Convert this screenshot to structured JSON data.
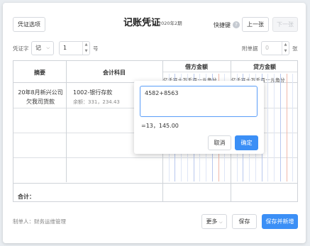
{
  "toolbar": {
    "options_label": "凭证选项",
    "title": "记账凭证",
    "period": "2020年2期",
    "shortcut_label": "快捷键",
    "help_glyph": "?",
    "prev_label": "上一张",
    "next_label": "下一张"
  },
  "meta": {
    "voucher_word_label": "凭证字",
    "voucher_word_value": "记",
    "number_value": "1",
    "number_unit": "号",
    "attachments_label": "附单据",
    "attachments_value": "0",
    "attachments_unit": "张"
  },
  "table": {
    "summary_header": "摘要",
    "account_header": "会计科目",
    "debit_header": "借方金额",
    "credit_header": "贷方金额",
    "digit_units": "亿千百十万千百十元角分",
    "rows": [
      {
        "summary": "20年8月新兴公司欠我司货款",
        "account": "1002-银行存款",
        "balance": "余额：331，234.43"
      }
    ],
    "total_label": "合计："
  },
  "popup": {
    "expression": "4582+8563",
    "result": "=13，145.00",
    "cancel_label": "取消",
    "confirm_label": "确定"
  },
  "footer": {
    "maker": "制单人：财务运维管理",
    "more_label": "更多",
    "save_label": "保存",
    "save_new_label": "保存并新增"
  },
  "colors": {
    "primary": "#3b8ff6",
    "digit_line_blue": "#b8c8ee",
    "digit_line_red": "#f0b8a8"
  }
}
